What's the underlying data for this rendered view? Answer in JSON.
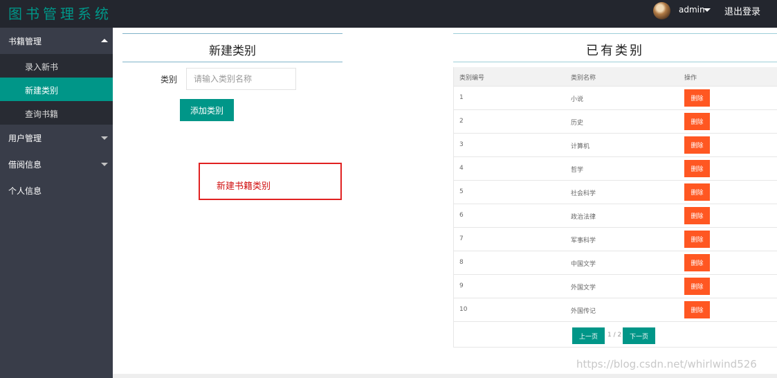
{
  "header": {
    "app_title": "图书管理系统",
    "user": "admin",
    "logout": "退出登录"
  },
  "sidebar": {
    "group_books": "书籍管理",
    "items": [
      "录入新书",
      "新建类别",
      "查询书籍"
    ],
    "active_item": "新建类别",
    "group_users": "用户管理",
    "group_borrow": "借阅信息",
    "personal": "个人信息"
  },
  "form": {
    "title": "新建类别",
    "field_label": "类别",
    "field_placeholder": "请输入类别名称",
    "field_value": "",
    "submit": "添加类别"
  },
  "annotation": "新建书籍类别",
  "table": {
    "title": "已有类别",
    "columns": [
      "类别编号",
      "类别名称",
      "操作"
    ],
    "rows": [
      {
        "id": "1",
        "name": "小说",
        "action": "删除"
      },
      {
        "id": "2",
        "name": "历史",
        "action": "删除"
      },
      {
        "id": "3",
        "name": "计算机",
        "action": "删除"
      },
      {
        "id": "4",
        "name": "哲学",
        "action": "删除"
      },
      {
        "id": "5",
        "name": "社会科学",
        "action": "删除"
      },
      {
        "id": "6",
        "name": "政治法律",
        "action": "删除"
      },
      {
        "id": "7",
        "name": "军事科学",
        "action": "删除"
      },
      {
        "id": "8",
        "name": "中国文学",
        "action": "删除"
      },
      {
        "id": "9",
        "name": "外国文学",
        "action": "删除"
      },
      {
        "id": "10",
        "name": "外国传记",
        "action": "删除"
      }
    ]
  },
  "pagination": {
    "prev": "上一页",
    "info": "1 / 2",
    "next": "下一页"
  },
  "watermark": "https://blog.csdn.net/whirlwind526",
  "colors": {
    "header_bg": "#23262e",
    "sidebar_bg": "#393d49",
    "accent": "#009688",
    "danger": "#ff5722"
  }
}
